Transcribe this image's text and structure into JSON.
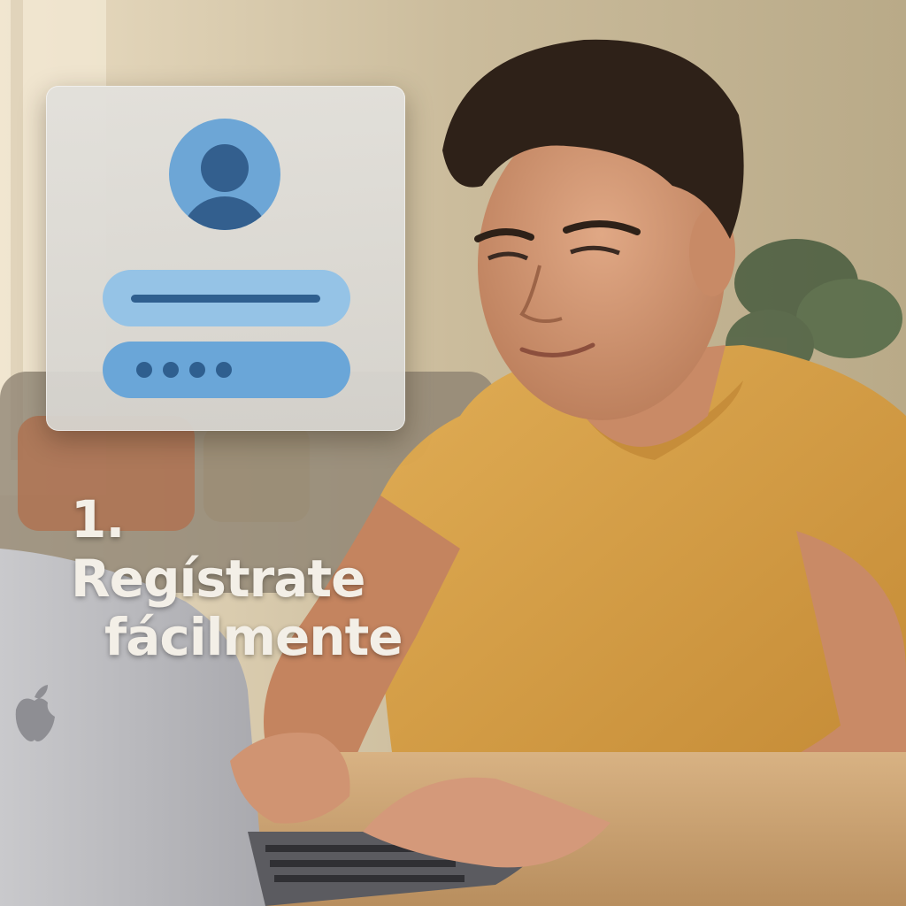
{
  "caption": {
    "line1": "1. Regístrate",
    "line2": "fácilmente"
  },
  "password_mask": "••••",
  "icons": {
    "avatar": "user-avatar-icon",
    "logo": "apple-logo-icon"
  },
  "colors": {
    "card": "#e2e0db",
    "avatar": "#6da6d6",
    "avatar_figure": "#335f8e",
    "username_field": "#95c3e6",
    "password_field": "#6aa6d8",
    "shirt": "#d8a24a",
    "caption_text": "#f3efe7"
  }
}
